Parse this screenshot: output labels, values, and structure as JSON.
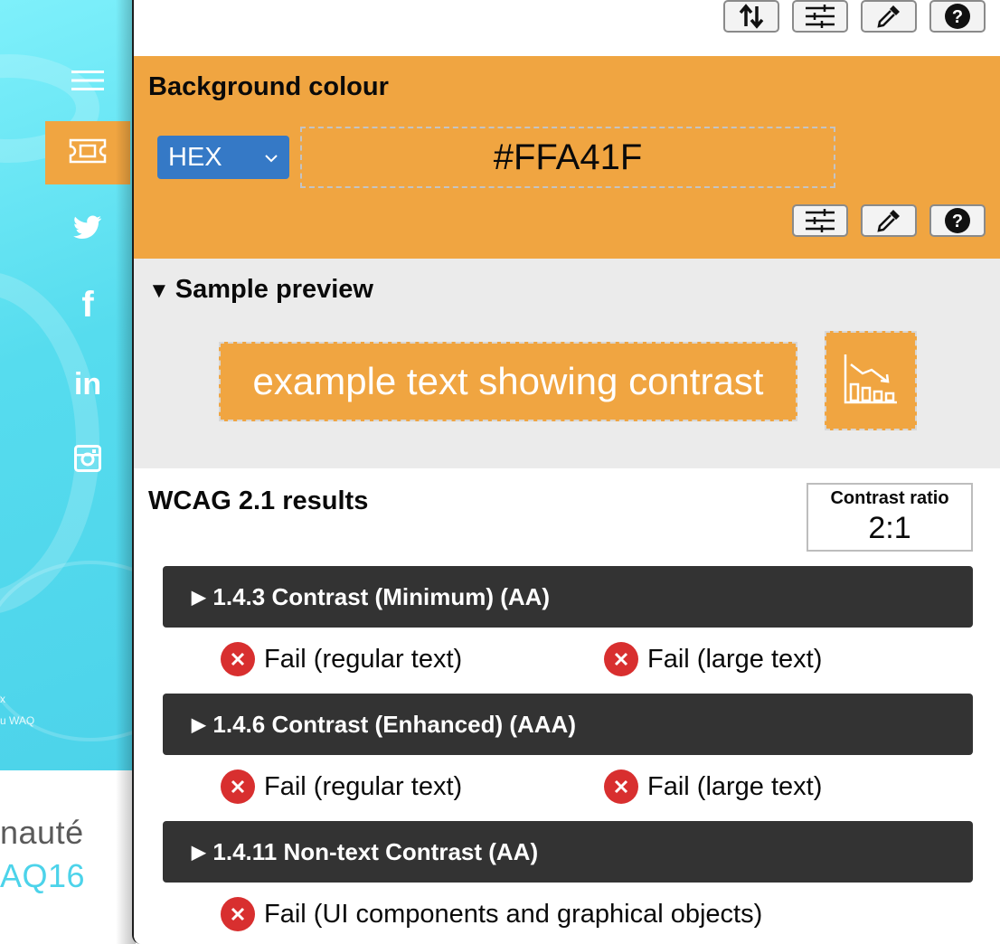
{
  "background_site": {
    "nav_icons": [
      "menu-icon",
      "ticket-icon",
      "twitter-icon",
      "facebook-icon",
      "linkedin-icon",
      "instagram-icon"
    ],
    "social_glyphs": {
      "facebook": "f",
      "linkedin": "in"
    },
    "hero_credit_1": "x",
    "hero_credit_2": "u WAQ",
    "text_line_1": "nauté",
    "text_line_2": "AQ16",
    "colors": {
      "hero": "#56dcee",
      "active_nav": "#f0a541",
      "accent_text": "#4cd3ea"
    }
  },
  "toolbar": {
    "buttons": [
      "swap-icon",
      "sliders-icon",
      "eyedropper-icon",
      "help-icon"
    ]
  },
  "background_colour": {
    "title": "Background colour",
    "format_select": {
      "value": "HEX",
      "icon": "chevron-down-icon"
    },
    "hex_value": "#FFA41F",
    "buttons": [
      "sliders-icon",
      "eyedropper-icon",
      "help-icon"
    ],
    "color": "#f0a541"
  },
  "sample_preview": {
    "title": "Sample preview",
    "expanded_marker": "▼",
    "sample_text": "example text showing contrast",
    "graphic_icon": "chart-icon"
  },
  "results": {
    "title": "WCAG 2.1 results",
    "contrast_ratio_label": "Contrast ratio",
    "contrast_ratio_value": "2:1",
    "collapsed_marker": "▶",
    "criteria": [
      {
        "label": "1.4.3 Contrast (Minimum) (AA)",
        "results": [
          "Fail (regular text)",
          "Fail (large text)"
        ]
      },
      {
        "label": "1.4.6 Contrast (Enhanced) (AAA)",
        "results": [
          "Fail (regular text)",
          "Fail (large text)"
        ]
      },
      {
        "label": "1.4.11 Non-text Contrast (AA)",
        "results": [
          "Fail (UI components and graphical objects)"
        ]
      }
    ],
    "fail_color": "#d82f2f"
  }
}
